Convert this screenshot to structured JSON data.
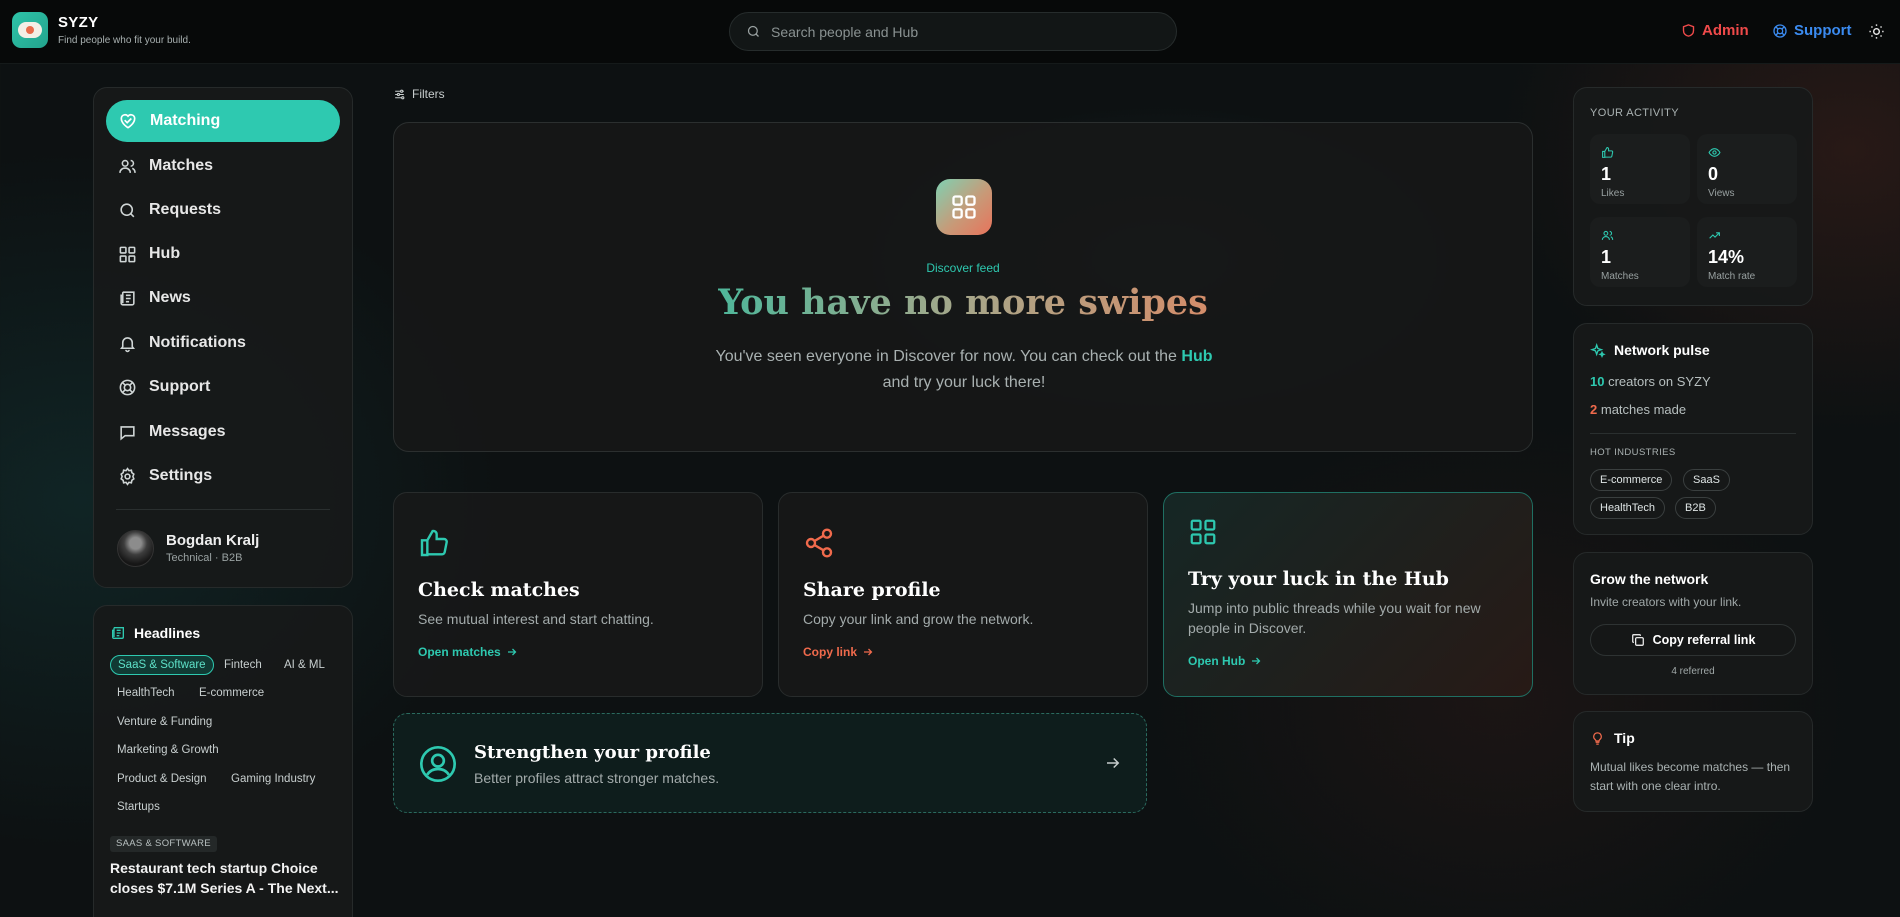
{
  "app": {
    "name": "SYZY",
    "tagline": "Find people who fit your build."
  },
  "header": {
    "search_placeholder": "Search people and Hub",
    "admin_label": "Admin",
    "support_label": "Support",
    "colors": {
      "admin": "#ef4a4a",
      "support": "#3b8bf0"
    }
  },
  "sidebar": {
    "items": [
      {
        "label": "Matching",
        "icon": "heart-handshake-icon",
        "active": true
      },
      {
        "label": "Matches",
        "icon": "users-icon"
      },
      {
        "label": "Requests",
        "icon": "search-icon"
      },
      {
        "label": "Hub",
        "icon": "grid-icon"
      },
      {
        "label": "News",
        "icon": "newspaper-icon"
      },
      {
        "label": "Notifications",
        "icon": "bell-icon"
      },
      {
        "label": "Support",
        "icon": "lifebuoy-icon"
      },
      {
        "label": "Messages",
        "icon": "message-icon"
      },
      {
        "label": "Settings",
        "icon": "gear-icon"
      }
    ],
    "user": {
      "name": "Bogdan Kralj",
      "role": "Technical · B2B"
    }
  },
  "headlines": {
    "title": "Headlines",
    "chips": [
      "SaaS & Software",
      "Fintech",
      "AI & ML",
      "HealthTech",
      "E-commerce",
      "Venture & Funding",
      "Marketing & Growth",
      "Product & Design",
      "Gaming Industry",
      "Startups"
    ],
    "selected_chip": "SaaS & Software",
    "article": {
      "tag": "SAAS & SOFTWARE",
      "title": "Restaurant tech startup Choice closes $7.1M Series A - The Next..."
    }
  },
  "main": {
    "filters_label": "Filters",
    "hero": {
      "kicker": "Discover feed",
      "title": "You have no more swipes",
      "desc_before": "You've seen everyone in Discover for now. You can check out the",
      "desc_link": "Hub",
      "desc_after": "and try your luck there!"
    },
    "actions": [
      {
        "title": "Check matches",
        "desc": "See mutual interest and start chatting.",
        "link": "Open matches",
        "icon": "thumbs-up-icon",
        "color": "#2ec9b0"
      },
      {
        "title": "Share profile",
        "desc": "Copy your link and grow the network.",
        "link": "Copy link",
        "icon": "share-icon",
        "color": "#f06a4c"
      },
      {
        "title": "Try your luck in the Hub",
        "desc": "Jump into public threads while you wait for new people in Discover.",
        "link": "Open Hub",
        "icon": "grid-icon",
        "color": "#2ec9b0"
      }
    ],
    "strengthen": {
      "title": "Strengthen your profile",
      "desc": "Better profiles attract stronger matches."
    }
  },
  "activity": {
    "title": "YOUR ACTIVITY",
    "stats": [
      {
        "value": "1",
        "label": "Likes",
        "icon": "thumbs-up-icon"
      },
      {
        "value": "0",
        "label": "Views",
        "icon": "eye-icon"
      },
      {
        "value": "1",
        "label": "Matches",
        "icon": "users-icon"
      },
      {
        "value": "14%",
        "label": "Match rate",
        "icon": "trending-up-icon"
      }
    ]
  },
  "pulse": {
    "title": "Network pulse",
    "creators_count": "10",
    "creators_label": "creators on SYZY",
    "matches_count": "2",
    "matches_label": "matches made",
    "industries_label": "HOT INDUSTRIES",
    "industries": [
      "E-commerce",
      "SaaS",
      "HealthTech",
      "B2B"
    ]
  },
  "grow": {
    "title": "Grow the network",
    "desc": "Invite creators with your link.",
    "button": "Copy referral link",
    "referred": "4 referred"
  },
  "tip": {
    "title": "Tip",
    "desc": "Mutual likes become matches — then start with one clear intro."
  },
  "accent": "#2ec9b0"
}
